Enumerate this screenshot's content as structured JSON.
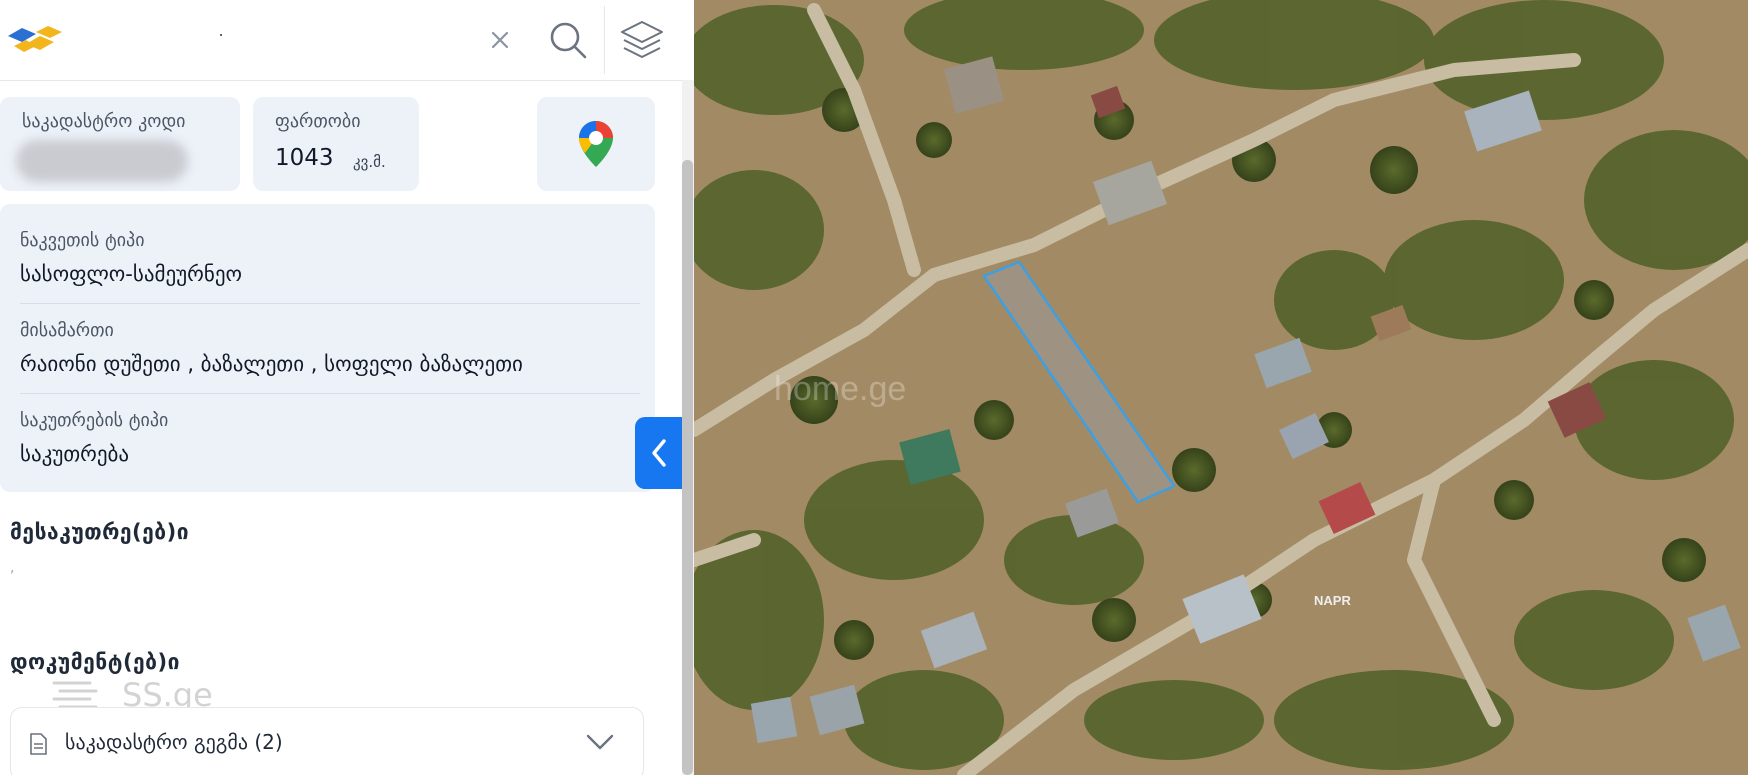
{
  "search": {
    "value": "."
  },
  "info_cards": {
    "cadastral_code_label": "საკადასტრო კოდი",
    "area_label": "ფართობი",
    "area_value": "1043",
    "area_unit": "კვ.მ."
  },
  "details": [
    {
      "label": "ნაკვეთის ტიპი",
      "value": "სასოფლო-სამეურნეო"
    },
    {
      "label": "მისამართი",
      "value": "რაიონი დუშეთი , ბაზალეთი , სოფელი ბაზალეთი"
    },
    {
      "label": "საკუთრების ტიპი",
      "value": "საკუთრება"
    }
  ],
  "owners": {
    "title": "მესაკუთრე(ებ)ი",
    "value": ","
  },
  "documents": {
    "title": "დოკუმენტ(ებ)ი",
    "items": [
      {
        "label": "საკადასტრო გეგმა (2)"
      }
    ]
  },
  "watermarks": {
    "ss": "SS.ge",
    "home": "home.ge"
  },
  "map": {
    "napr_label": "NAPR"
  },
  "icons": {
    "logo": "napr-logo",
    "clear": "close-icon",
    "search": "search-icon",
    "layers": "layers-icon",
    "google_maps": "map-pin-icon",
    "collapse": "chevron-left-icon",
    "document": "file-icon",
    "expand": "chevron-down-icon"
  },
  "colors": {
    "accent": "#1677f0",
    "card_bg": "#edf2f9",
    "parcel_outline": "#3aa0e6"
  }
}
